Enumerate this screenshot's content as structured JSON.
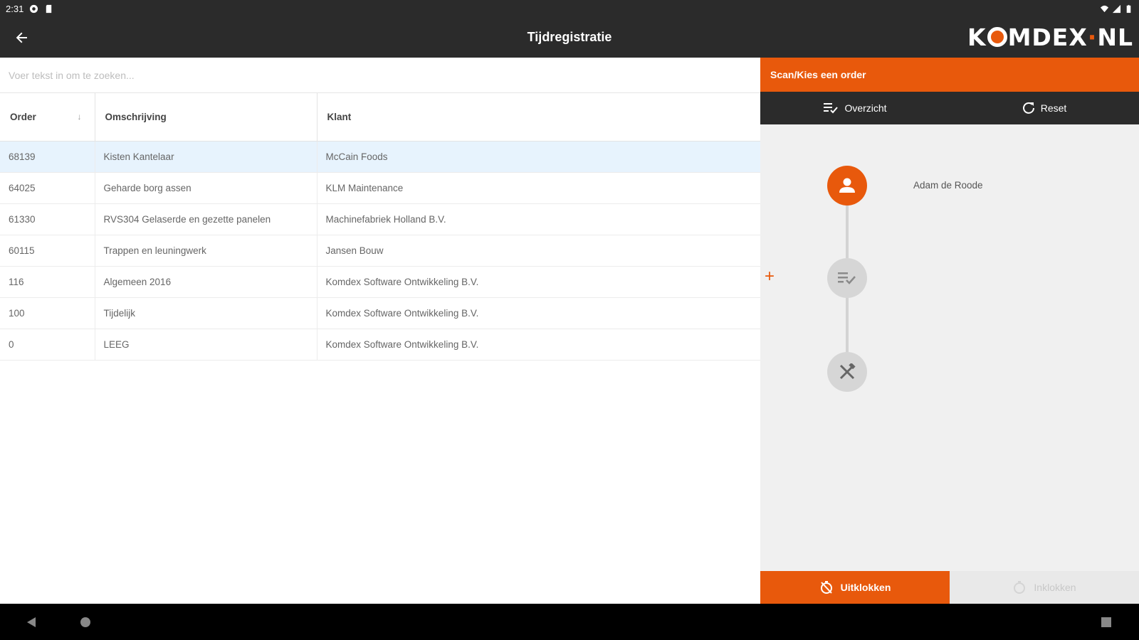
{
  "status_bar": {
    "time": "2:31",
    "icons": [
      "settings-circle-icon",
      "sd-card-icon",
      "wifi-icon",
      "signal-icon",
      "battery-icon"
    ]
  },
  "app_bar": {
    "title": "Tijdregistratie",
    "back_icon": "arrow-left-icon",
    "logo_text_before": "K",
    "logo_text_after": "MDEX",
    "logo_text_tld": "NL"
  },
  "search": {
    "placeholder": "Voer tekst in om te zoeken..."
  },
  "table": {
    "columns": [
      "Order",
      "Omschrijving",
      "Klant"
    ],
    "rows": [
      {
        "order": "68139",
        "omschrijving": "Kisten Kantelaar",
        "klant": "McCain Foods",
        "selected": true
      },
      {
        "order": "64025",
        "omschrijving": "Geharde borg assen",
        "klant": "KLM Maintenance",
        "selected": false
      },
      {
        "order": "61330",
        "omschrijving": "RVS304 Gelaserde en gezette panelen",
        "klant": "Machinefabriek Holland B.V.",
        "selected": false
      },
      {
        "order": "60115",
        "omschrijving": "Trappen en leuningwerk",
        "klant": "Jansen Bouw",
        "selected": false
      },
      {
        "order": "116",
        "omschrijving": "Algemeen 2016",
        "klant": "Komdex Software Ontwikkeling B.V.",
        "selected": false
      },
      {
        "order": "100",
        "omschrijving": "Tijdelijk",
        "klant": "Komdex Software Ontwikkeling B.V.",
        "selected": false
      },
      {
        "order": "0",
        "omschrijving": "LEEG",
        "klant": "Komdex Software Ontwikkeling B.V.",
        "selected": false
      }
    ]
  },
  "right_panel": {
    "header": "Scan/Kies een order",
    "overview_label": "Overzicht",
    "reset_label": "Reset",
    "user_name": "Adam de Roode",
    "add_symbol": "+",
    "clock_out_label": "Uitklokken",
    "clock_in_label": "Inklokken"
  },
  "colors": {
    "accent": "#e8590c",
    "dark_bar": "#2b2b2b",
    "selected_row": "#e7f3fd",
    "panel_bg": "#f0f0f0"
  }
}
